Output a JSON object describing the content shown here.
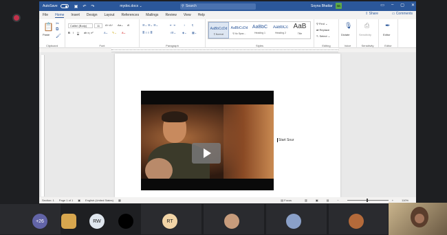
{
  "word": {
    "titlebar": {
      "autosave_label": "AutoSave",
      "autosave_state": "Off",
      "doc_name": "mydoc.docx ⌄",
      "search_placeholder": "Search",
      "user_name": "Soyna Bhattar",
      "user_initials": "SB"
    },
    "menu": [
      "File",
      "Home",
      "Insert",
      "Design",
      "Layout",
      "References",
      "Mailings",
      "Review",
      "View",
      "Help"
    ],
    "share_label": "Share",
    "comments_label": "Comments",
    "ribbon": {
      "clipboard": {
        "paste": "Paste",
        "label": "Clipboard"
      },
      "font": {
        "name": "Calibri (Body)",
        "size": "11",
        "label": "Font",
        "bold": "B",
        "italic": "I",
        "underline": "U"
      },
      "paragraph": {
        "label": "Paragraph"
      },
      "styles": {
        "label": "Styles",
        "items": [
          {
            "sample": "AaBbCcDd",
            "name": "¶ Normal"
          },
          {
            "sample": "AaBbCcDd",
            "name": "¶ No Spac..."
          },
          {
            "sample": "AaBbC",
            "name": "Heading 1"
          },
          {
            "sample": "AaBbCc",
            "name": "Heading 2"
          },
          {
            "sample": "AaB",
            "name": "Title"
          }
        ]
      },
      "editing": {
        "find": "Find",
        "replace": "Replace",
        "select": "Select",
        "label": "Editing"
      },
      "voice": {
        "dictate": "Dictate",
        "label": "Voice"
      },
      "sensitivity": {
        "button": "Sensitivity",
        "label": "Sensitivity"
      },
      "editor": {
        "button": "Editor",
        "label": "Editor"
      }
    },
    "document": {
      "caret_text": "Start Sour"
    },
    "status": {
      "section": "Section: 1",
      "page": "Page 1 of 1",
      "language": "English (United States)",
      "focus": "Focus",
      "zoom": "110%"
    }
  },
  "meeting": {
    "overflow": "+26",
    "participants": [
      {
        "initials": "RW"
      },
      {
        "initials": "RT"
      }
    ]
  }
}
